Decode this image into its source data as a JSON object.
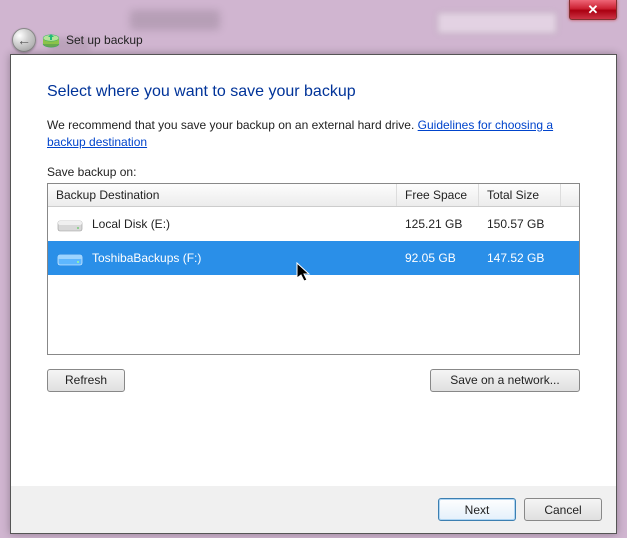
{
  "window": {
    "title": "Set up backup"
  },
  "heading": "Select where you want to save your backup",
  "description": "We recommend that you save your backup on an external hard drive.",
  "link_text": "Guidelines for choosing a backup destination",
  "save_label": "Save backup on:",
  "columns": {
    "destination": "Backup Destination",
    "free": "Free Space",
    "total": "Total Size"
  },
  "drives": [
    {
      "name": "Local Disk (E:)",
      "free": "125.21 GB",
      "total": "150.57 GB",
      "selected": false,
      "type": "internal"
    },
    {
      "name": "ToshibaBackups (F:)",
      "free": "92.05 GB",
      "total": "147.52 GB",
      "selected": true,
      "type": "external"
    }
  ],
  "buttons": {
    "refresh": "Refresh",
    "network": "Save on a network...",
    "next": "Next",
    "cancel": "Cancel"
  }
}
